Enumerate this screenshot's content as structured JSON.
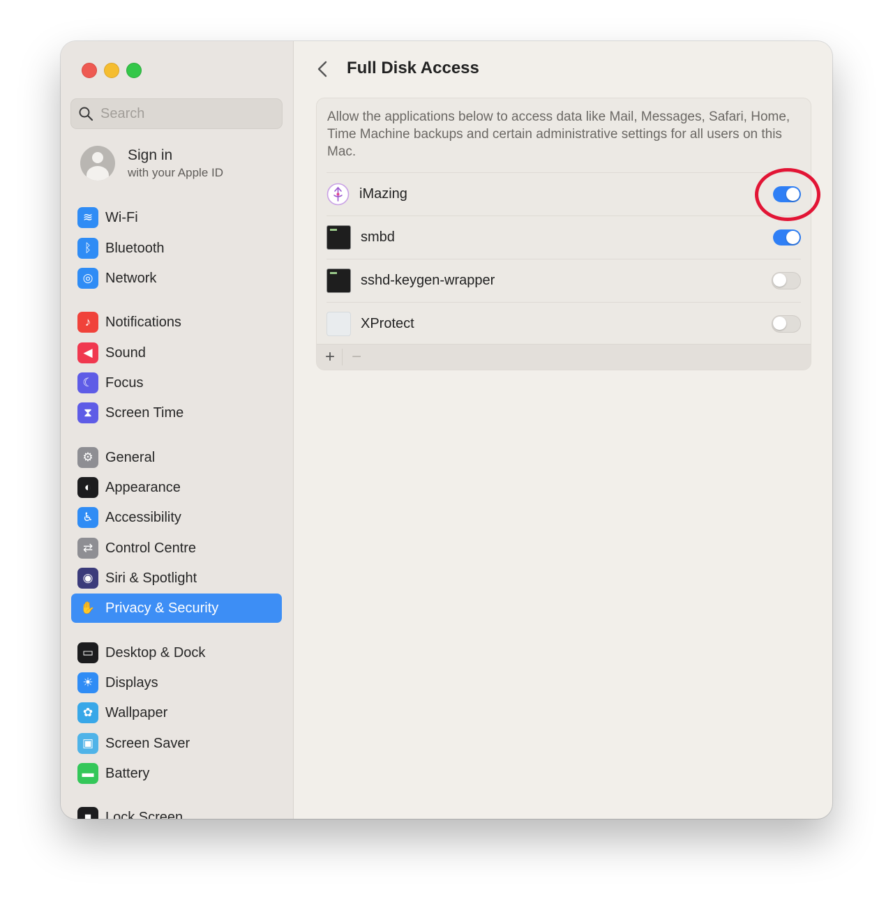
{
  "window": {
    "traffic_lights": [
      "close",
      "minimize",
      "maximize"
    ]
  },
  "sidebar": {
    "search": {
      "placeholder": "Search"
    },
    "account": {
      "title": "Sign in",
      "subtitle": "with your Apple ID"
    },
    "items": [
      {
        "label": "Wi-Fi",
        "icon": "wifi-icon",
        "color": "#2f8cf5"
      },
      {
        "label": "Bluetooth",
        "icon": "bluetooth-icon",
        "color": "#2f8cf5"
      },
      {
        "label": "Network",
        "icon": "globe-icon",
        "color": "#2f8cf5"
      },
      {
        "label": "Notifications",
        "icon": "bell-icon",
        "color": "#f0423a"
      },
      {
        "label": "Sound",
        "icon": "speaker-icon",
        "color": "#f0384f"
      },
      {
        "label": "Focus",
        "icon": "moon-icon",
        "color": "#5e5ce6"
      },
      {
        "label": "Screen Time",
        "icon": "hourglass-icon",
        "color": "#5e5ce6"
      },
      {
        "label": "General",
        "icon": "gear-icon",
        "color": "#8e8e93"
      },
      {
        "label": "Appearance",
        "icon": "appearance-icon",
        "color": "#1c1c1e"
      },
      {
        "label": "Accessibility",
        "icon": "accessibility-icon",
        "color": "#2f8cf5"
      },
      {
        "label": "Control Centre",
        "icon": "switches-icon",
        "color": "#8e8e93"
      },
      {
        "label": "Siri & Spotlight",
        "icon": "siri-icon",
        "color": "#3b3b7a"
      },
      {
        "label": "Privacy & Security",
        "icon": "hand-icon",
        "color": "#3d8ef5",
        "selected": true
      },
      {
        "label": "Desktop & Dock",
        "icon": "dock-icon",
        "color": "#1c1c1e"
      },
      {
        "label": "Displays",
        "icon": "sun-icon",
        "color": "#2f8cf5"
      },
      {
        "label": "Wallpaper",
        "icon": "flower-icon",
        "color": "#38a7e8"
      },
      {
        "label": "Screen Saver",
        "icon": "screensaver-icon",
        "color": "#4fb3e8"
      },
      {
        "label": "Battery",
        "icon": "battery-icon",
        "color": "#34c759"
      },
      {
        "label": "Lock Screen",
        "icon": "lock-icon",
        "color": "#1c1c1e"
      }
    ]
  },
  "content": {
    "title": "Full Disk Access",
    "description": "Allow the applications below to access data like Mail, Messages, Safari, Home, Time Machine backups and certain administrative settings for all users on this Mac.",
    "apps": [
      {
        "name": "iMazing",
        "icon": "imazing-icon",
        "enabled": true
      },
      {
        "name": "smbd",
        "icon": "terminal-icon",
        "enabled": true
      },
      {
        "name": "sshd-keygen-wrapper",
        "icon": "terminal-icon",
        "enabled": false
      },
      {
        "name": "XProtect",
        "icon": "xprotect-icon",
        "enabled": false
      }
    ],
    "add_label": "+",
    "remove_label": "−",
    "highlight_color": "#e21535"
  }
}
